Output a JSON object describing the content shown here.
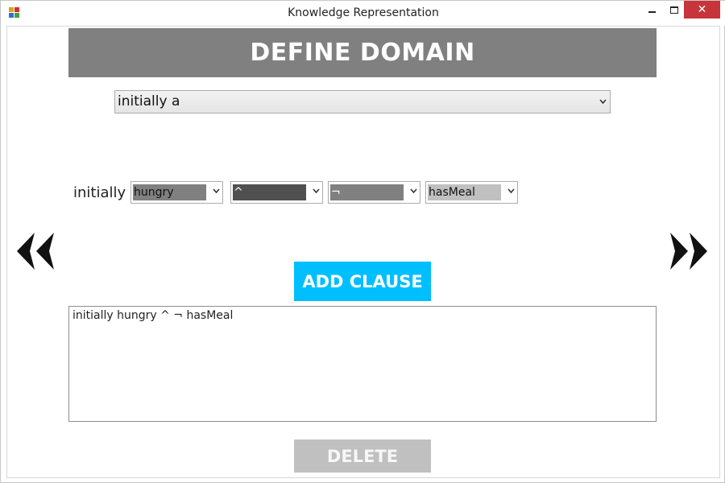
{
  "window": {
    "title": "Knowledge Representation",
    "icon": "app-form-icon",
    "controls": {
      "minimize": "minimize-icon",
      "maximize": "maximize-icon",
      "close": "✕"
    }
  },
  "header": {
    "title": "DEFINE DOMAIN"
  },
  "statement_select": {
    "value": "initially a",
    "chevron": "⌄"
  },
  "clause": {
    "label": "initially",
    "combos": [
      {
        "value": "hungry",
        "chevron": "⌄",
        "bg": "#808080",
        "color": "#111111"
      },
      {
        "value": "^",
        "chevron": "⌄",
        "bg": "#505050",
        "color": "#ffffff"
      },
      {
        "value": "¬",
        "chevron": "⌄",
        "bg": "#808080",
        "color": "#ffffff"
      },
      {
        "value": "hasMeal",
        "chevron": "⌄",
        "bg": "#c0c0c0",
        "color": "#111111"
      }
    ]
  },
  "navigation": {
    "prev_icon": "double-chevron-left-icon",
    "next_icon": "double-chevron-right-icon"
  },
  "add_button": {
    "label": "ADD CLAUSE",
    "color": "#00bfff"
  },
  "output": {
    "text": "initially hungry ^  ¬ hasMeal"
  },
  "delete_button": {
    "label": "DELETE",
    "color": "#c0c0c0"
  }
}
